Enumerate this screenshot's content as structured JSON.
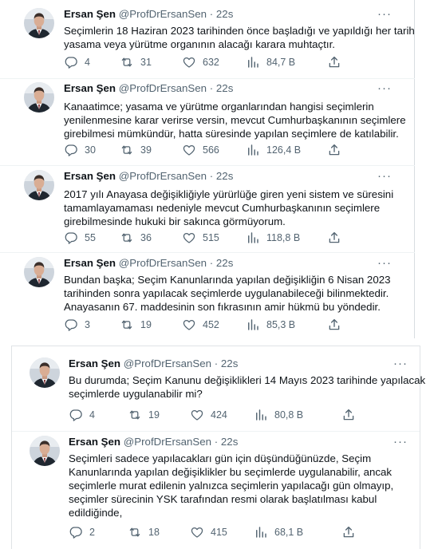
{
  "author": {
    "name": "Ersan Şen",
    "handle": "@ProfDrErsanSen",
    "separator": "·",
    "time": "22s"
  },
  "icons": {
    "reply": "reply-icon",
    "retweet": "retweet-icon",
    "like": "like-icon",
    "views": "views-icon",
    "share": "share-icon",
    "more": "more-icon"
  },
  "colors": {
    "text": "#0f1419",
    "muted": "#536471",
    "divider": "#eff3f4"
  },
  "tweets": [
    {
      "lines": [
        "Seçimlerin 18 Haziran 2023 tarihinden önce başladığı ve yapıldığı her tarih",
        "yasama veya yürütme organının alacağı karara muhtaçtır."
      ],
      "replies": "4",
      "retweets": "31",
      "likes": "632",
      "views": "84,7 B"
    },
    {
      "lines": [
        "Kanaatimce; yasama ve yürütme organlarından hangisi seçimlerin",
        "yenilenmesine karar verirse versin, mevcut Cumhurbaşkanının seçimlere",
        "girebilmesi mümkündür, hatta süresinde yapılan seçimlere de katılabilir."
      ],
      "replies": "30",
      "retweets": "39",
      "likes": "566",
      "views": "126,4 B"
    },
    {
      "lines": [
        "2017 yılı Anayasa değişikliğiyle yürürlüğe giren yeni sistem ve süresini",
        "tamamlayamaması nedeniyle mevcut Cumhurbaşkanının seçimlere",
        "girebilmesinde hukuki bir sakınca görmüyorum."
      ],
      "replies": "55",
      "retweets": "36",
      "likes": "515",
      "views": "118,8 B"
    },
    {
      "lines": [
        "Bundan başka; Seçim Kanunlarında yapılan değişikliğin 6 Nisan 2023",
        "tarihinden sonra yapılacak seçimlerde uygulanabileceği bilinmektedir.",
        "Anayasanın 67. maddesinin son fıkrasının amir hükmü bu yöndedir."
      ],
      "replies": "3",
      "retweets": "19",
      "likes": "452",
      "views": "85,3 B"
    },
    {
      "lines": [
        "Bu durumda; Seçim Kanunu değişiklikleri 14 Mayıs 2023 tarihinde yapılacak",
        "seçimlerde uygulanabilir mi?"
      ],
      "replies": "4",
      "retweets": "19",
      "likes": "424",
      "views": "80,8 B"
    },
    {
      "lines": [
        "Seçimleri sadece yapılacakları gün için düşündüğünüzde, Seçim",
        "Kanunlarında yapılan değişiklikler bu seçimlerde uygulanabilir, ancak",
        "seçimlerle murat edilenin yalnızca seçimlerin yapılacağı gün olmayıp,",
        "seçimler sürecinin YSK tarafından resmi olarak başlatılması kabul",
        "edildiğinde,"
      ],
      "replies": "2",
      "retweets": "18",
      "likes": "415",
      "views": "68,1 B"
    }
  ]
}
